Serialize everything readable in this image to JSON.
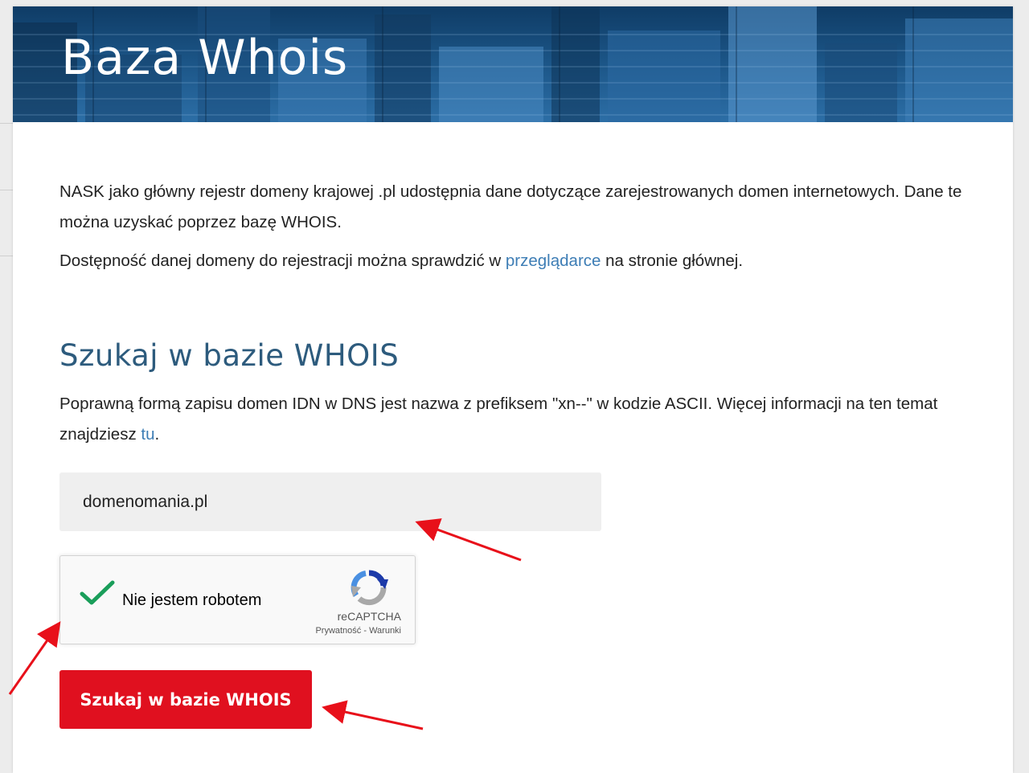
{
  "banner": {
    "title": "Baza Whois"
  },
  "intro": {
    "paragraph1": "NASK jako główny rejestr domeny krajowej .pl udostępnia dane dotyczące zarejestrowanych domen internetowych. Dane te można uzyskać poprzez bazę WHOIS.",
    "paragraph2_before": "Dostępność danej domeny do rejestracji można sprawdzić w ",
    "paragraph2_link": "przeglądarce",
    "paragraph2_after": " na stronie głównej."
  },
  "search": {
    "title": "Szukaj w bazie WHOIS",
    "info_text": "Poprawną formą zapisu domen IDN w DNS jest nazwa z prefiksem \"xn--\" w kodzie ASCII. Więcej informacji na ten temat znajdziesz ",
    "info_link": "tu",
    "info_end": ".",
    "input_value": "domenomania.pl",
    "button_label": "Szukaj w bazie WHOIS"
  },
  "recaptcha": {
    "checked": true,
    "label": "Nie jestem robotem",
    "brand": "reCAPTCHA",
    "terms": "Prywatność - Warunki"
  },
  "colors": {
    "link": "#3d7db5",
    "section_title": "#2d5b7d",
    "button": "#e0101f",
    "check": "#1a9e5a",
    "annotation_arrow": "#e8101a"
  },
  "icons": {
    "checkmark": "checkmark-icon",
    "recaptcha_logo": "recaptcha-logo-icon"
  }
}
